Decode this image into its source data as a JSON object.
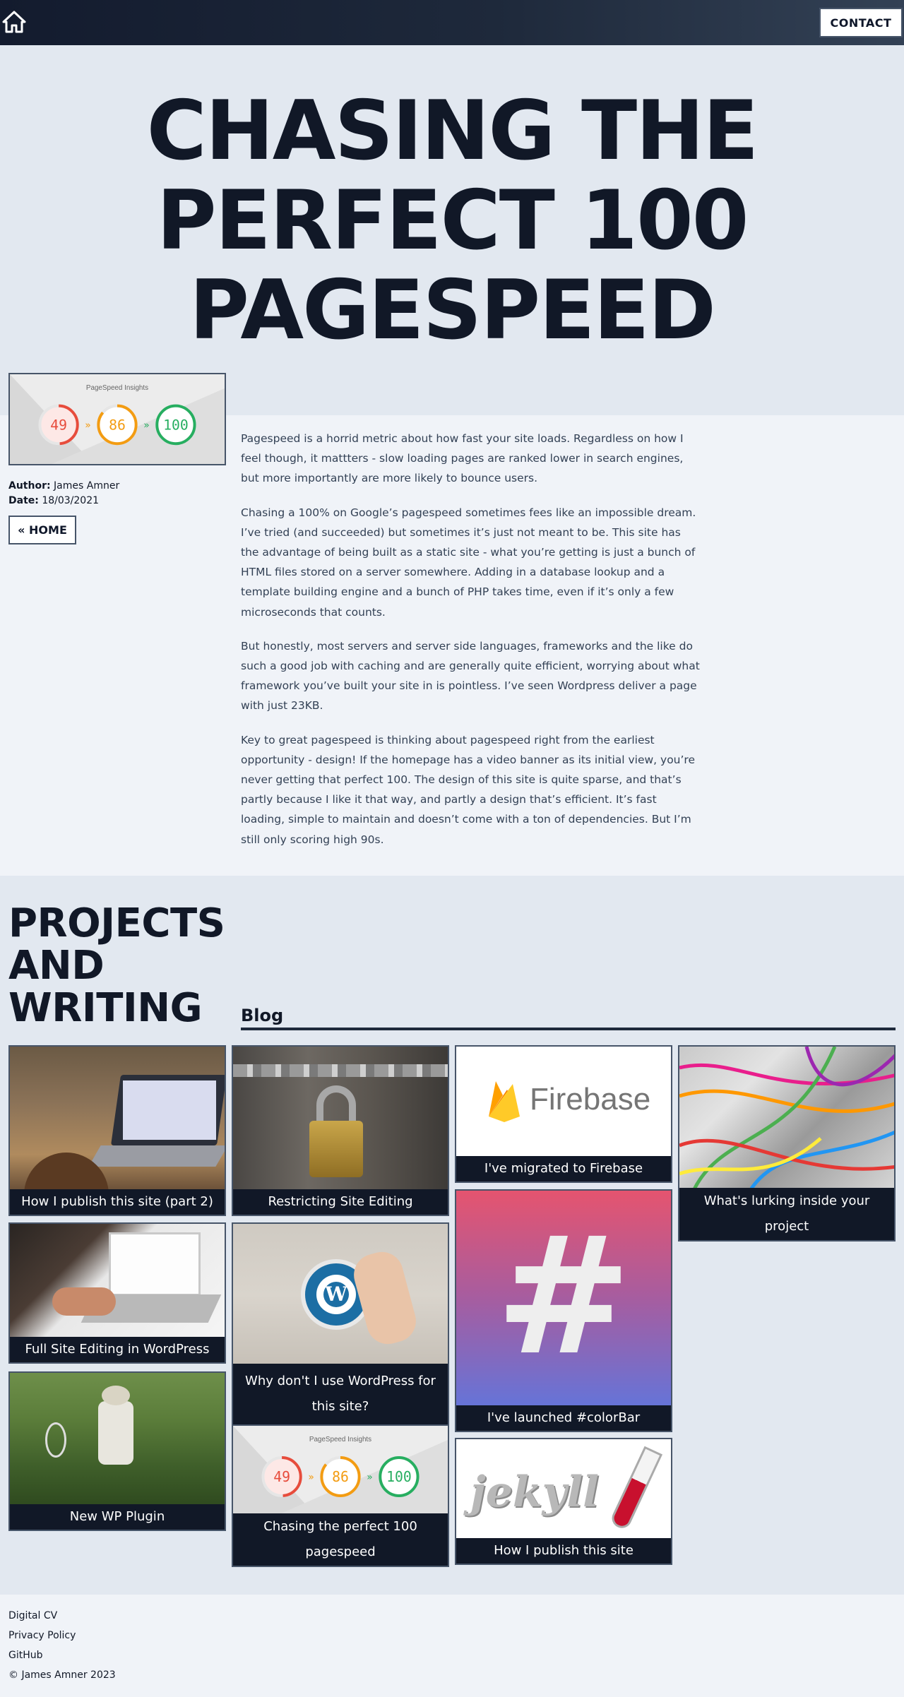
{
  "header": {
    "home_icon": "home-icon",
    "contact_label": "CONTACT"
  },
  "hero": {
    "title_lines": [
      "CHASING THE",
      "PERFECT 100",
      "PAGESPEED"
    ]
  },
  "pagespeed_card": {
    "label": "PageSpeed Insights",
    "scores": [
      "49",
      "86",
      "100"
    ],
    "score_colors": [
      "#e74c3c",
      "#f39c12",
      "#27ae60"
    ]
  },
  "meta": {
    "author_label": "Author:",
    "author": "James Amner",
    "date_label": "Date:",
    "date": "18/03/2021",
    "home_button": "« HOME"
  },
  "article": {
    "paragraphs": [
      "Pagespeed is a horrid metric about how fast your site loads. Regardless on how I feel though, it mattters - slow loading pages are ranked lower in search engines, but more importantly are more likely to bounce users.",
      "Chasing a 100% on Google’s pagespeed sometimes fees like an impossible dream. I’ve tried (and succeeded) but sometimes it’s just not meant to be. This site has the advantage of being built as a static site - what you’re getting is just a bunch of HTML files stored on a server somewhere. Adding in a database lookup and a template building engine and a bunch of PHP takes time, even if it’s only a few microseconds that counts.",
      "But honestly, most servers and server side languages, frameworks and the like do such a good job with caching and are generally quite efficient, worrying about what framework you’ve built your site in is pointless. I’ve seen Wordpress deliver a page with just 23KB.",
      "Key to great pagespeed is thinking about pagespeed right from the earliest opportunity - design! If the homepage has a video banner as its initial view, you’re never getting that perfect 100. The design of this site is quite sparse, and that’s partly because I like it that way, and partly a design that’s efficient. It’s fast loading, simple to maintain and doesn’t come with a ton of dependencies. But I’m still only scoring high 90s."
    ]
  },
  "projects": {
    "title_lines": [
      "PROJECTS",
      "AND",
      "WRITING"
    ],
    "blog_heading": "Blog",
    "cards": [
      {
        "caption": "How I publish this site (part 2)",
        "image": "laptop-photo"
      },
      {
        "caption": "Full Site Editing in WordPress",
        "image": "typing-laptop-photo"
      },
      {
        "caption": "New WP Plugin",
        "image": "field-photo"
      },
      {
        "caption": "Restricting Site Editing",
        "image": "padlock-photo"
      },
      {
        "caption": "Why don't I use WordPress for this site?",
        "image": "wordpress-logo-photo"
      },
      {
        "caption": "Chasing the perfect 100 pagespeed",
        "image": "pagespeed-scores"
      },
      {
        "caption": "I've migrated to Firebase",
        "image": "firebase-logo",
        "logo_text": "Firebase"
      },
      {
        "caption": "I've launched #colorBar",
        "image": "hash-gradient",
        "logo_text": "#"
      },
      {
        "caption": "How I publish this site",
        "image": "jekyll-logo",
        "logo_text": "jekyll"
      },
      {
        "caption": "What's lurking inside your project",
        "image": "cables-photo"
      }
    ]
  },
  "footer": {
    "links": [
      "Digital CV",
      "Privacy Policy",
      "GitHub"
    ],
    "copyright": "© James Amner 2023"
  }
}
